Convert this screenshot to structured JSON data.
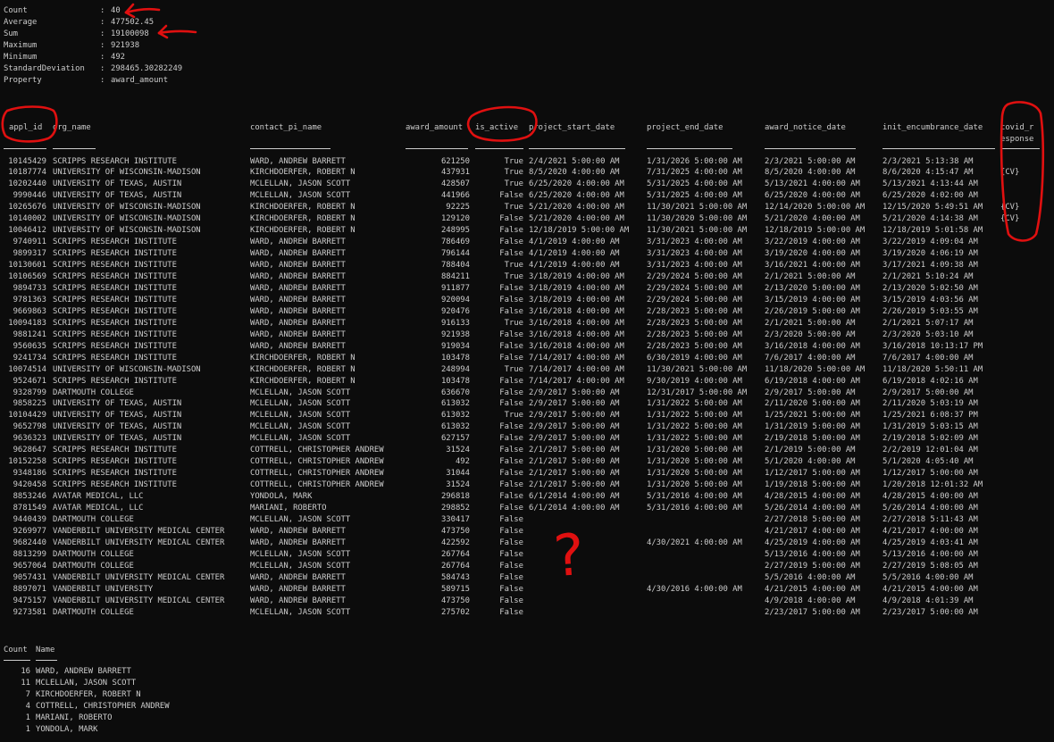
{
  "stats": [
    {
      "label": "Count",
      "value": "40"
    },
    {
      "label": "Average",
      "value": "477502.45"
    },
    {
      "label": "Sum",
      "value": "19100098"
    },
    {
      "label": "Maximum",
      "value": "921938"
    },
    {
      "label": "Minimum",
      "value": "492"
    },
    {
      "label": "StandardDeviation",
      "value": "298465.30282249"
    },
    {
      "label": "Property",
      "value": "award_amount"
    }
  ],
  "stats_separator": ":",
  "table": {
    "headers": {
      "appl_id": "appl_id",
      "org_name": "org_name",
      "contact_pi_name": "contact_pi_name",
      "award_amount": "award_amount",
      "is_active": "is_active",
      "project_start_date": "project_start_date",
      "project_end_date": "project_end_date",
      "award_notice_date": "award_notice_date",
      "init_encumbrance_date": "init_encumbrance_date",
      "covid_response_1": "covid_r",
      "covid_response_2": "esponse"
    },
    "rows": [
      [
        "10145429",
        "SCRIPPS RESEARCH INSTITUTE",
        "WARD, ANDREW BARRETT",
        "621250",
        "True",
        "2/4/2021 5:00:00 AM",
        "1/31/2026 5:00:00 AM",
        "2/3/2021 5:00:00 AM",
        "2/3/2021 5:13:38 AM",
        ""
      ],
      [
        "10187774",
        "UNIVERSITY OF WISCONSIN-MADISON",
        "KIRCHDOERFER, ROBERT N",
        "437931",
        "True",
        "8/5/2020 4:00:00 AM",
        "7/31/2025 4:00:00 AM",
        "8/5/2020 4:00:00 AM",
        "8/6/2020 4:15:47 AM",
        "{CV}"
      ],
      [
        "10202440",
        "UNIVERSITY OF TEXAS, AUSTIN",
        "MCLELLAN, JASON SCOTT",
        "428507",
        "True",
        "6/25/2020 4:00:00 AM",
        "5/31/2025 4:00:00 AM",
        "5/13/2021 4:00:00 AM",
        "5/13/2021 4:13:44 AM",
        ""
      ],
      [
        "9990446",
        "UNIVERSITY OF TEXAS, AUSTIN",
        "MCLELLAN, JASON SCOTT",
        "441966",
        "False",
        "6/25/2020 4:00:00 AM",
        "5/31/2025 4:00:00 AM",
        "6/25/2020 4:00:00 AM",
        "6/25/2020 4:02:00 AM",
        ""
      ],
      [
        "10265676",
        "UNIVERSITY OF WISCONSIN-MADISON",
        "KIRCHDOERFER, ROBERT N",
        "92225",
        "True",
        "5/21/2020 4:00:00 AM",
        "11/30/2021 5:00:00 AM",
        "12/14/2020 5:00:00 AM",
        "12/15/2020 5:49:51 AM",
        "{CV}"
      ],
      [
        "10140002",
        "UNIVERSITY OF WISCONSIN-MADISON",
        "KIRCHDOERFER, ROBERT N",
        "129120",
        "False",
        "5/21/2020 4:00:00 AM",
        "11/30/2020 5:00:00 AM",
        "5/21/2020 4:00:00 AM",
        "5/21/2020 4:14:38 AM",
        "{CV}"
      ],
      [
        "10046412",
        "UNIVERSITY OF WISCONSIN-MADISON",
        "KIRCHDOERFER, ROBERT N",
        "248995",
        "False",
        "12/18/2019 5:00:00 AM",
        "11/30/2021 5:00:00 AM",
        "12/18/2019 5:00:00 AM",
        "12/18/2019 5:01:58 AM",
        ""
      ],
      [
        "9740911",
        "SCRIPPS RESEARCH INSTITUTE",
        "WARD, ANDREW BARRETT",
        "786469",
        "False",
        "4/1/2019 4:00:00 AM",
        "3/31/2023 4:00:00 AM",
        "3/22/2019 4:00:00 AM",
        "3/22/2019 4:09:04 AM",
        ""
      ],
      [
        "9899317",
        "SCRIPPS RESEARCH INSTITUTE",
        "WARD, ANDREW BARRETT",
        "796144",
        "False",
        "4/1/2019 4:00:00 AM",
        "3/31/2023 4:00:00 AM",
        "3/19/2020 4:00:00 AM",
        "3/19/2020 4:06:19 AM",
        ""
      ],
      [
        "10130601",
        "SCRIPPS RESEARCH INSTITUTE",
        "WARD, ANDREW BARRETT",
        "788404",
        "True",
        "4/1/2019 4:00:00 AM",
        "3/31/2023 4:00:00 AM",
        "3/16/2021 4:00:00 AM",
        "3/17/2021 4:09:38 AM",
        ""
      ],
      [
        "10106569",
        "SCRIPPS RESEARCH INSTITUTE",
        "WARD, ANDREW BARRETT",
        "884211",
        "True",
        "3/18/2019 4:00:00 AM",
        "2/29/2024 5:00:00 AM",
        "2/1/2021 5:00:00 AM",
        "2/1/2021 5:10:24 AM",
        ""
      ],
      [
        "9894733",
        "SCRIPPS RESEARCH INSTITUTE",
        "WARD, ANDREW BARRETT",
        "911877",
        "False",
        "3/18/2019 4:00:00 AM",
        "2/29/2024 5:00:00 AM",
        "2/13/2020 5:00:00 AM",
        "2/13/2020 5:02:50 AM",
        ""
      ],
      [
        "9781363",
        "SCRIPPS RESEARCH INSTITUTE",
        "WARD, ANDREW BARRETT",
        "920094",
        "False",
        "3/18/2019 4:00:00 AM",
        "2/29/2024 5:00:00 AM",
        "3/15/2019 4:00:00 AM",
        "3/15/2019 4:03:56 AM",
        ""
      ],
      [
        "9669863",
        "SCRIPPS RESEARCH INSTITUTE",
        "WARD, ANDREW BARRETT",
        "920476",
        "False",
        "3/16/2018 4:00:00 AM",
        "2/28/2023 5:00:00 AM",
        "2/26/2019 5:00:00 AM",
        "2/26/2019 5:03:55 AM",
        ""
      ],
      [
        "10094183",
        "SCRIPPS RESEARCH INSTITUTE",
        "WARD, ANDREW BARRETT",
        "916133",
        "True",
        "3/16/2018 4:00:00 AM",
        "2/28/2023 5:00:00 AM",
        "2/1/2021 5:00:00 AM",
        "2/1/2021 5:07:17 AM",
        ""
      ],
      [
        "9881241",
        "SCRIPPS RESEARCH INSTITUTE",
        "WARD, ANDREW BARRETT",
        "921938",
        "False",
        "3/16/2018 4:00:00 AM",
        "2/28/2023 5:00:00 AM",
        "2/3/2020 5:00:00 AM",
        "2/3/2020 5:03:10 AM",
        ""
      ],
      [
        "9560635",
        "SCRIPPS RESEARCH INSTITUTE",
        "WARD, ANDREW BARRETT",
        "919034",
        "False",
        "3/16/2018 4:00:00 AM",
        "2/28/2023 5:00:00 AM",
        "3/16/2018 4:00:00 AM",
        "3/16/2018 10:13:17 PM",
        ""
      ],
      [
        "9241734",
        "SCRIPPS RESEARCH INSTITUTE",
        "KIRCHDOERFER, ROBERT N",
        "103478",
        "False",
        "7/14/2017 4:00:00 AM",
        "6/30/2019 4:00:00 AM",
        "7/6/2017 4:00:00 AM",
        "7/6/2017 4:00:00 AM",
        ""
      ],
      [
        "10074514",
        "UNIVERSITY OF WISCONSIN-MADISON",
        "KIRCHDOERFER, ROBERT N",
        "248994",
        "True",
        "7/14/2017 4:00:00 AM",
        "11/30/2021 5:00:00 AM",
        "11/18/2020 5:00:00 AM",
        "11/18/2020 5:50:11 AM",
        ""
      ],
      [
        "9524671",
        "SCRIPPS RESEARCH INSTITUTE",
        "KIRCHDOERFER, ROBERT N",
        "103478",
        "False",
        "7/14/2017 4:00:00 AM",
        "9/30/2019 4:00:00 AM",
        "6/19/2018 4:00:00 AM",
        "6/19/2018 4:02:16 AM",
        ""
      ],
      [
        "9328799",
        "DARTMOUTH COLLEGE",
        "MCLELLAN, JASON SCOTT",
        "636670",
        "False",
        "2/9/2017 5:00:00 AM",
        "12/31/2017 5:00:00 AM",
        "2/9/2017 5:00:00 AM",
        "2/9/2017 5:00:00 AM",
        ""
      ],
      [
        "9858225",
        "UNIVERSITY OF TEXAS, AUSTIN",
        "MCLELLAN, JASON SCOTT",
        "613032",
        "False",
        "2/9/2017 5:00:00 AM",
        "1/31/2022 5:00:00 AM",
        "2/11/2020 5:00:00 AM",
        "2/11/2020 5:03:19 AM",
        ""
      ],
      [
        "10104429",
        "UNIVERSITY OF TEXAS, AUSTIN",
        "MCLELLAN, JASON SCOTT",
        "613032",
        "True",
        "2/9/2017 5:00:00 AM",
        "1/31/2022 5:00:00 AM",
        "1/25/2021 5:00:00 AM",
        "1/25/2021 6:08:37 PM",
        ""
      ],
      [
        "9652798",
        "UNIVERSITY OF TEXAS, AUSTIN",
        "MCLELLAN, JASON SCOTT",
        "613032",
        "False",
        "2/9/2017 5:00:00 AM",
        "1/31/2022 5:00:00 AM",
        "1/31/2019 5:00:00 AM",
        "1/31/2019 5:03:15 AM",
        ""
      ],
      [
        "9636323",
        "UNIVERSITY OF TEXAS, AUSTIN",
        "MCLELLAN, JASON SCOTT",
        "627157",
        "False",
        "2/9/2017 5:00:00 AM",
        "1/31/2022 5:00:00 AM",
        "2/19/2018 5:00:00 AM",
        "2/19/2018 5:02:09 AM",
        ""
      ],
      [
        "9628647",
        "SCRIPPS RESEARCH INSTITUTE",
        "COTTRELL, CHRISTOPHER ANDREW",
        "31524",
        "False",
        "2/1/2017 5:00:00 AM",
        "1/31/2020 5:00:00 AM",
        "2/1/2019 5:00:00 AM",
        "2/2/2019 12:01:04 AM",
        ""
      ],
      [
        "10152258",
        "SCRIPPS RESEARCH INSTITUTE",
        "COTTRELL, CHRISTOPHER ANDREW",
        "492",
        "False",
        "2/1/2017 5:00:00 AM",
        "1/31/2020 5:00:00 AM",
        "5/1/2020 4:00:00 AM",
        "5/1/2020 4:05:40 AM",
        ""
      ],
      [
        "9348186",
        "SCRIPPS RESEARCH INSTITUTE",
        "COTTRELL, CHRISTOPHER ANDREW",
        "31044",
        "False",
        "2/1/2017 5:00:00 AM",
        "1/31/2020 5:00:00 AM",
        "1/12/2017 5:00:00 AM",
        "1/12/2017 5:00:00 AM",
        ""
      ],
      [
        "9420458",
        "SCRIPPS RESEARCH INSTITUTE",
        "COTTRELL, CHRISTOPHER ANDREW",
        "31524",
        "False",
        "2/1/2017 5:00:00 AM",
        "1/31/2020 5:00:00 AM",
        "1/19/2018 5:00:00 AM",
        "1/20/2018 12:01:32 AM",
        ""
      ],
      [
        "8853246",
        "AVATAR MEDICAL, LLC",
        "YONDOLA, MARK",
        "296818",
        "False",
        "6/1/2014 4:00:00 AM",
        "5/31/2016 4:00:00 AM",
        "4/28/2015 4:00:00 AM",
        "4/28/2015 4:00:00 AM",
        ""
      ],
      [
        "8781549",
        "AVATAR MEDICAL, LLC",
        "MARIANI, ROBERTO",
        "298852",
        "False",
        "6/1/2014 4:00:00 AM",
        "5/31/2016 4:00:00 AM",
        "5/26/2014 4:00:00 AM",
        "5/26/2014 4:00:00 AM",
        ""
      ],
      [
        "9440439",
        "DARTMOUTH COLLEGE",
        "MCLELLAN, JASON SCOTT",
        "330417",
        "False",
        "",
        "",
        "2/27/2018 5:00:00 AM",
        "2/27/2018 5:11:43 AM",
        ""
      ],
      [
        "9269977",
        "VANDERBILT UNIVERSITY MEDICAL CENTER",
        "WARD, ANDREW BARRETT",
        "473750",
        "False",
        "",
        "",
        "4/21/2017 4:00:00 AM",
        "4/21/2017 4:00:00 AM",
        ""
      ],
      [
        "9682440",
        "VANDERBILT UNIVERSITY MEDICAL CENTER",
        "WARD, ANDREW BARRETT",
        "422592",
        "False",
        "",
        "4/30/2021 4:00:00 AM",
        "4/25/2019 4:00:00 AM",
        "4/25/2019 4:03:41 AM",
        ""
      ],
      [
        "8813299",
        "DARTMOUTH COLLEGE",
        "MCLELLAN, JASON SCOTT",
        "267764",
        "False",
        "",
        "",
        "5/13/2016 4:00:00 AM",
        "5/13/2016 4:00:00 AM",
        ""
      ],
      [
        "9657064",
        "DARTMOUTH COLLEGE",
        "MCLELLAN, JASON SCOTT",
        "267764",
        "False",
        "",
        "",
        "2/27/2019 5:00:00 AM",
        "2/27/2019 5:08:05 AM",
        ""
      ],
      [
        "9057431",
        "VANDERBILT UNIVERSITY MEDICAL CENTER",
        "WARD, ANDREW BARRETT",
        "584743",
        "False",
        "",
        "",
        "5/5/2016 4:00:00 AM",
        "5/5/2016 4:00:00 AM",
        ""
      ],
      [
        "8897071",
        "VANDERBILT UNIVERSITY",
        "WARD, ANDREW BARRETT",
        "589715",
        "False",
        "",
        "4/30/2016 4:00:00 AM",
        "4/21/2015 4:00:00 AM",
        "4/21/2015 4:00:00 AM",
        ""
      ],
      [
        "9475157",
        "VANDERBILT UNIVERSITY MEDICAL CENTER",
        "WARD, ANDREW BARRETT",
        "473750",
        "False",
        "",
        "",
        "4/9/2018 4:00:00 AM",
        "4/9/2018 4:01:39 AM",
        ""
      ],
      [
        "9273581",
        "DARTMOUTH COLLEGE",
        "MCLELLAN, JASON SCOTT",
        "275702",
        "False",
        "",
        "",
        "2/23/2017 5:00:00 AM",
        "2/23/2017 5:00:00 AM",
        ""
      ]
    ]
  },
  "group": {
    "headers": {
      "count": "Count",
      "name": "Name"
    },
    "rows": [
      [
        "16",
        "WARD, ANDREW BARRETT"
      ],
      [
        "11",
        "MCLELLAN, JASON SCOTT"
      ],
      [
        "7",
        "KIRCHDOERFER, ROBERT N"
      ],
      [
        "4",
        "COTTRELL, CHRISTOPHER ANDREW"
      ],
      [
        "1",
        "MARIANI, ROBERTO"
      ],
      [
        "1",
        "YONDOLA, MARK"
      ]
    ]
  },
  "annotation": {
    "question_mark": "?"
  },
  "colors": {
    "background": "#0c0c0c",
    "text": "#cccccc",
    "annotation": "#e01010"
  }
}
